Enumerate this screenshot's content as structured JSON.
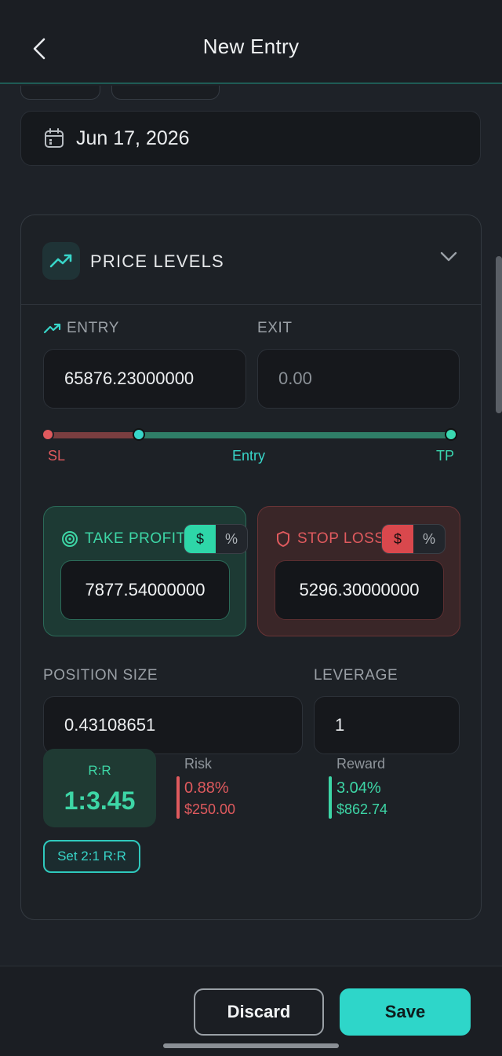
{
  "header": {
    "title": "New Entry",
    "back_icon": "chevron-left-icon"
  },
  "date_field": {
    "value": "Jun 17, 2026",
    "icon": "calendar-icon"
  },
  "price_levels": {
    "title": "PRICE LEVELS",
    "icon": "trending-up-icon",
    "entry_label": "ENTRY",
    "exit_label": "EXIT",
    "entry_value": "65876.23000000",
    "exit_placeholder": "0.00",
    "slider": {
      "sl_label": "SL",
      "entry_label": "Entry",
      "tp_label": "TP",
      "entry_position": 0.22
    },
    "take_profit": {
      "label": "TAKE PROFIT",
      "value": "7877.54000000",
      "unit_dollar": "$",
      "unit_percent": "%"
    },
    "stop_loss": {
      "label": "STOP LOSS",
      "value": "5296.30000000",
      "unit_dollar": "$",
      "unit_percent": "%"
    },
    "position_size": {
      "label": "POSITION SIZE",
      "value": "0.43108651"
    },
    "leverage": {
      "label": "LEVERAGE",
      "value": "1"
    },
    "rr": {
      "label": "R:R",
      "value": "1:3.45"
    },
    "risk": {
      "label": "Risk",
      "percent": "0.88%",
      "amount": "$250.00"
    },
    "reward": {
      "label": "Reward",
      "percent": "3.04%",
      "amount": "$862.74"
    },
    "set_rr_button": "Set 2:1 R:R"
  },
  "footer": {
    "discard": "Discard",
    "save": "Save"
  },
  "colors": {
    "accent": "#2ed6c9",
    "profit": "#3dd6a6",
    "loss": "#e05a5e"
  }
}
